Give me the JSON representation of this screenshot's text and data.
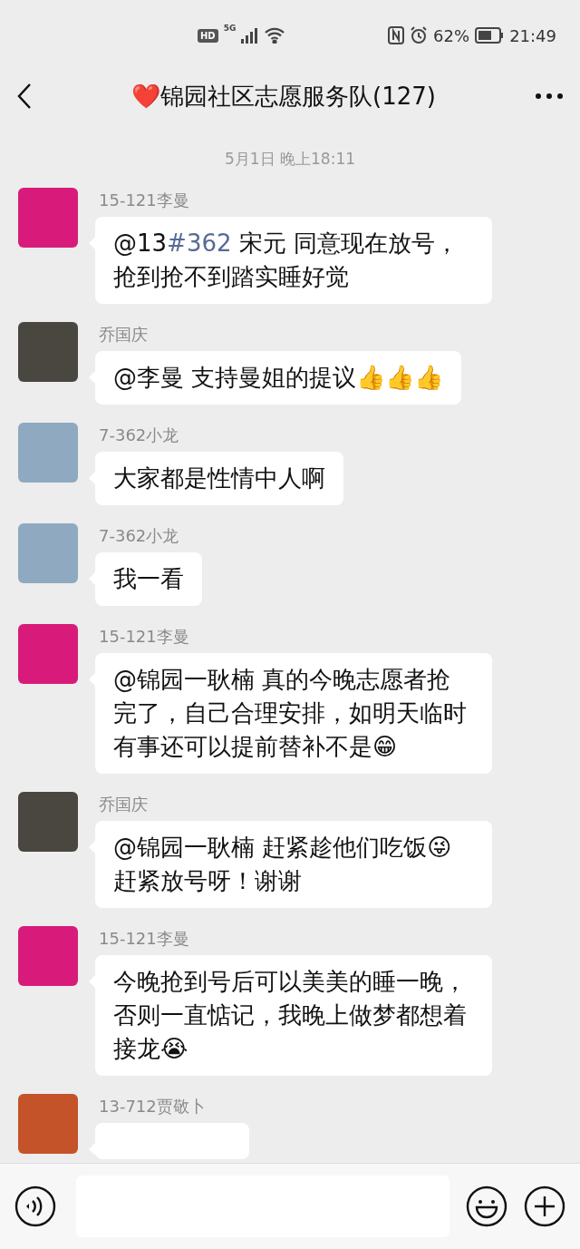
{
  "status_bar": {
    "left_badges": [
      "HD",
      "5G"
    ],
    "battery": "62%",
    "time": "21:49"
  },
  "header": {
    "title": "❤️锦园社区志愿服务队(127)"
  },
  "timestamp": "5月1日 晚上18:11",
  "messages": [
    {
      "sender": "15-121李曼",
      "color": "#d81b7a",
      "segments": [
        {
          "kind": "plain",
          "text": "@13"
        },
        {
          "kind": "link",
          "text": "#362"
        },
        {
          "kind": "plain",
          "text": " 宋元  同意现在放号，抢到抢不到踏实睡好觉"
        }
      ]
    },
    {
      "sender": "乔国庆",
      "color": "#4a4640",
      "segments": [
        {
          "kind": "plain",
          "text": "@李曼  支持曼姐的提议👍👍👍"
        }
      ]
    },
    {
      "sender": "7-362小龙",
      "color": "#8fa9c0",
      "segments": [
        {
          "kind": "plain",
          "text": "大家都是性情中人啊"
        }
      ]
    },
    {
      "sender": "7-362小龙",
      "color": "#8fa9c0",
      "segments": [
        {
          "kind": "plain",
          "text": "我一看"
        }
      ]
    },
    {
      "sender": "15-121李曼",
      "color": "#d81b7a",
      "segments": [
        {
          "kind": "plain",
          "text": "@锦园一耿楠  真的今晚志愿者抢完了，自己合理安排，如明天临时有事还可以提前替补不是😁"
        }
      ]
    },
    {
      "sender": "乔国庆",
      "color": "#4a4640",
      "segments": [
        {
          "kind": "plain",
          "text": "@锦园一耿楠  赶紧趁他们吃饭😜赶紧放号呀！谢谢"
        }
      ]
    },
    {
      "sender": "15-121李曼",
      "color": "#d81b7a",
      "segments": [
        {
          "kind": "plain",
          "text": "今晚抢到号后可以美美的睡一晚，否则一直惦记，我晚上做梦都想着接龙😭"
        }
      ]
    },
    {
      "sender": "13-712贾敬卜",
      "color": "#c4532a"
    }
  ]
}
